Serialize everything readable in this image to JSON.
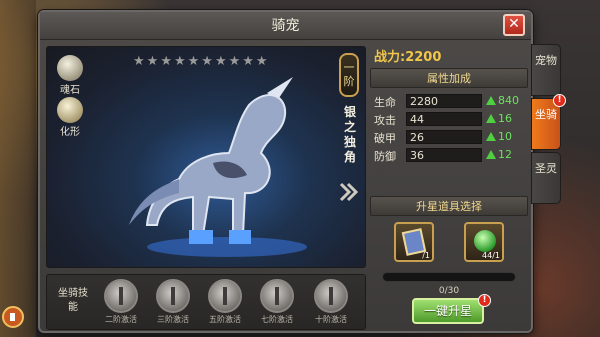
{
  "window": {
    "title": "骑宠",
    "close_label": "✕"
  },
  "display": {
    "stars_total": 10,
    "side_buttons": [
      {
        "label": "魂石",
        "icon": "soul-stone-icon"
      },
      {
        "label": "化形",
        "icon": "transform-icon"
      }
    ],
    "grade": "一阶",
    "mount_name": "银之独角"
  },
  "skills": {
    "label": "坐骑技能",
    "items": [
      {
        "caption": "二阶激活"
      },
      {
        "caption": "三阶激活"
      },
      {
        "caption": "五阶激活"
      },
      {
        "caption": "七阶激活"
      },
      {
        "caption": "十阶激活"
      }
    ]
  },
  "stats": {
    "power": "战力:2200",
    "attr_title": "属性加成",
    "attributes": [
      {
        "name": "生命",
        "value": "2280",
        "gain": "840"
      },
      {
        "name": "攻击",
        "value": "44",
        "gain": "16"
      },
      {
        "name": "破甲",
        "value": "26",
        "gain": "10"
      },
      {
        "name": "防御",
        "value": "36",
        "gain": "12"
      }
    ],
    "item_title": "升星道具选择",
    "items": [
      {
        "count": "/1",
        "icon": "scroll-card-icon"
      },
      {
        "count": "44/1",
        "icon": "green-orb-icon"
      }
    ],
    "progress_text": "0/30",
    "upgrade_label": "一键升星",
    "badge": "!"
  },
  "tabs": [
    {
      "label": "宠物",
      "active": false
    },
    {
      "label": "坐骑",
      "active": true
    },
    {
      "label": "圣灵",
      "active": false
    }
  ],
  "colors": {
    "accent": "#f07a1a",
    "power": "#f2c64a",
    "gain": "#6ee060",
    "close": "#b02a1e"
  }
}
